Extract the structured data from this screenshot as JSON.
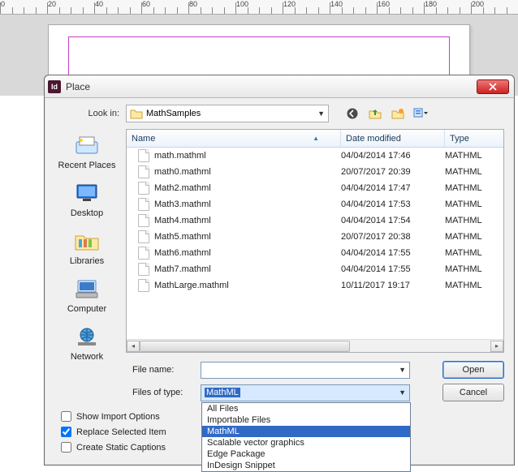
{
  "ruler": {
    "ticks": [
      20,
      40,
      60,
      80,
      100,
      120,
      140,
      160,
      180,
      200
    ]
  },
  "dialog": {
    "title": "Place",
    "app_icon_text": "Id",
    "look_in_label": "Look in:",
    "look_in_value": "MathSamples",
    "toolbar": {
      "back": "back-icon",
      "up": "up-one-level-icon",
      "newfolder": "new-folder-icon",
      "views": "views-menu-icon"
    },
    "columns": {
      "name": "Name",
      "date": "Date modified",
      "type": "Type"
    },
    "files": [
      {
        "name": "math.mathml",
        "date": "04/04/2014 17:46",
        "type": "MATHML"
      },
      {
        "name": "math0.mathml",
        "date": "20/07/2017 20:39",
        "type": "MATHML"
      },
      {
        "name": "Math2.mathml",
        "date": "04/04/2014 17:47",
        "type": "MATHML"
      },
      {
        "name": "Math3.mathml",
        "date": "04/04/2014 17:53",
        "type": "MATHML"
      },
      {
        "name": "Math4.mathml",
        "date": "04/04/2014 17:54",
        "type": "MATHML"
      },
      {
        "name": "Math5.mathml",
        "date": "20/07/2017 20:38",
        "type": "MATHML"
      },
      {
        "name": "Math6.mathml",
        "date": "04/04/2014 17:55",
        "type": "MATHML"
      },
      {
        "name": "Math7.mathml",
        "date": "04/04/2014 17:55",
        "type": "MATHML"
      },
      {
        "name": "MathLarge.mathml",
        "date": "10/11/2017 19:17",
        "type": "MATHML"
      }
    ],
    "filename_label": "File name:",
    "filename_value": "",
    "filetype_label": "Files of type:",
    "filetype_value": "MathML",
    "filetype_options": [
      "All Files",
      "Importable Files",
      "MathML",
      "Scalable vector graphics",
      "Edge Package",
      "InDesign Snippet"
    ],
    "open_label": "Open",
    "cancel_label": "Cancel",
    "chk_import": "Show Import Options",
    "chk_replace": "Replace Selected Item",
    "chk_captions": "Create Static Captions"
  },
  "places": [
    {
      "id": "recent",
      "label": "Recent Places"
    },
    {
      "id": "desktop",
      "label": "Desktop"
    },
    {
      "id": "libraries",
      "label": "Libraries"
    },
    {
      "id": "computer",
      "label": "Computer"
    },
    {
      "id": "network",
      "label": "Network"
    }
  ],
  "colors": {
    "highlight": "#316ac5",
    "magenta_frame": "#c53fc5"
  }
}
